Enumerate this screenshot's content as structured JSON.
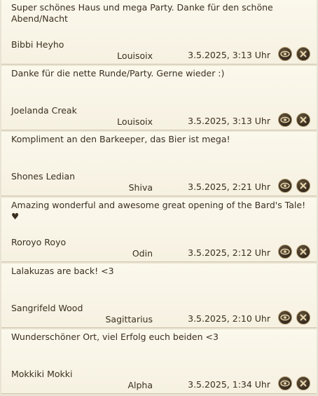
{
  "entries": [
    {
      "message": "Super schönes Haus und mega Party. Danke für den schöne Abend/Nacht",
      "author": "Bibbi Heyho",
      "world": "Louisoix",
      "datetime": "3.5.2025, 3:13 Uhr"
    },
    {
      "message": "Danke für die nette Runde/Party. Gerne wieder :)",
      "author": "Joelanda Creak",
      "world": "Louisoix",
      "datetime": "3.5.2025, 3:13 Uhr"
    },
    {
      "message": "Kompliment an den Barkeeper, das Bier ist mega!",
      "author": "Shones Ledian",
      "world": "Shiva",
      "datetime": "3.5.2025, 2:21 Uhr"
    },
    {
      "message": "Amazing wonderful and awesome great opening of the Bard's Tale! ♥",
      "author": "Roroyo Royo",
      "world": "Odin",
      "datetime": "3.5.2025, 2:12 Uhr"
    },
    {
      "message": "Lalakuzas are back! <3",
      "author": "Sangrifeld Wood",
      "world": "Sagittarius",
      "datetime": "3.5.2025, 2:10 Uhr"
    },
    {
      "message": "Wunderschöner Ort, viel Erfolg euch beiden <3",
      "author": "Mokkiki Mokki",
      "world": "Alpha",
      "datetime": "3.5.2025, 1:34 Uhr"
    }
  ],
  "icons": {
    "view": "eye-icon",
    "delete": "close-icon"
  },
  "colors": {
    "background": "#f8f4e6",
    "text": "#3a2f1f",
    "button": "#3b2f21",
    "button_border": "#b29c73"
  }
}
